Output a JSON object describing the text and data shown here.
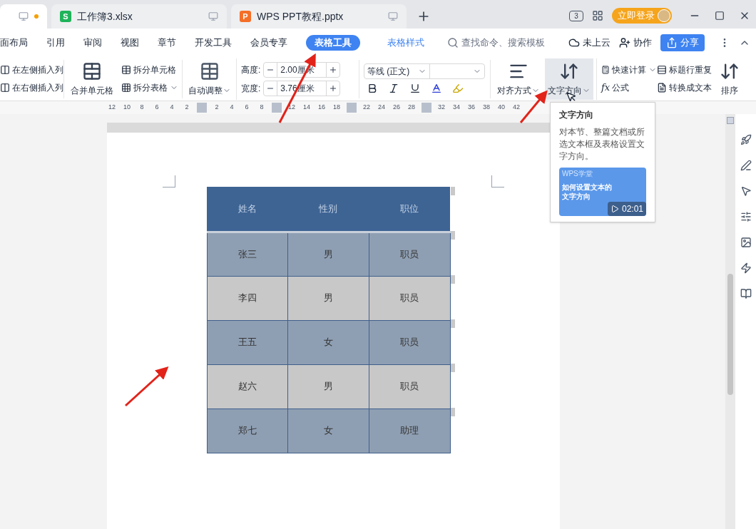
{
  "tabs": [
    {
      "selected": true,
      "modified": true
    },
    {
      "label": "工作簿3.xlsx",
      "logo": "S",
      "color": "#1fb35b",
      "selected": false,
      "modified": false
    },
    {
      "label": "WPS PPT教程.pptx",
      "logo": "P",
      "color": "#f46f27",
      "selected": false,
      "modified": false
    }
  ],
  "title_bar": {
    "login": "立即登录",
    "page_count": "3"
  },
  "menu": {
    "items": [
      {
        "label": "面布局",
        "kind": "plain"
      },
      {
        "label": "引用",
        "kind": "plain"
      },
      {
        "label": "审阅",
        "kind": "plain"
      },
      {
        "label": "视图",
        "kind": "plain"
      },
      {
        "label": "章节",
        "kind": "plain"
      },
      {
        "label": "开发工具",
        "kind": "plain"
      },
      {
        "label": "会员专享",
        "kind": "plain"
      },
      {
        "label": "表格工具",
        "kind": "context",
        "selected": true
      },
      {
        "label": "表格样式",
        "kind": "context",
        "selected": false
      }
    ],
    "search": {
      "placeholder": "查找命令、搜索模板"
    },
    "cloud": "未上云",
    "collab": "协作",
    "share": "分享"
  },
  "ribbon": {
    "insert_left": "在左侧插入列",
    "insert_right": "在右侧插入列",
    "merge": "合并单元格",
    "split_cell": "拆分单元格",
    "split_table": "拆分表格",
    "autofit": "自动调整",
    "height": {
      "label": "高度:",
      "value": "2.00厘米"
    },
    "width": {
      "label": "宽度:",
      "value": "3.76厘米"
    },
    "font": {
      "value": "等线 (正文)"
    },
    "align": "对齐方式",
    "direction": {
      "label": "文字方向",
      "hovered": true
    },
    "quick_calc": "快速计算",
    "formula_symbol": "fx",
    "formula": "公式",
    "repeat_header": "标题行重复",
    "to_text": "转换成文本",
    "sort": "排序"
  },
  "ruler": [
    {
      "kind": "num",
      "label": "12"
    },
    {
      "kind": "num",
      "label": "10"
    },
    {
      "kind": "num",
      "label": "8"
    },
    {
      "kind": "num",
      "label": "6"
    },
    {
      "kind": "num",
      "label": "4"
    },
    {
      "kind": "num",
      "label": "2"
    },
    {
      "kind": "marker"
    },
    {
      "kind": "num",
      "label": "2"
    },
    {
      "kind": "num",
      "label": "4"
    },
    {
      "kind": "num",
      "label": "6"
    },
    {
      "kind": "num",
      "label": "8"
    },
    {
      "kind": "marker"
    },
    {
      "kind": "num",
      "label": "12"
    },
    {
      "kind": "num",
      "label": "14"
    },
    {
      "kind": "num",
      "label": "16"
    },
    {
      "kind": "num",
      "label": "18"
    },
    {
      "kind": "marker"
    },
    {
      "kind": "num",
      "label": "22"
    },
    {
      "kind": "num",
      "label": "24"
    },
    {
      "kind": "num",
      "label": "26"
    },
    {
      "kind": "num",
      "label": "28"
    },
    {
      "kind": "marker"
    },
    {
      "kind": "num",
      "label": "32"
    },
    {
      "kind": "num",
      "label": "34"
    },
    {
      "kind": "num",
      "label": "36"
    },
    {
      "kind": "num",
      "label": "38"
    },
    {
      "kind": "num",
      "label": "40"
    },
    {
      "kind": "num",
      "label": "42"
    }
  ],
  "tooltip": {
    "title": "文字方向",
    "description": "对本节、整篇文档或所选文本框及表格设置文字方向。",
    "video": {
      "source": "WPS学堂",
      "title": "如何设置文本的文字方向",
      "duration": "02:01"
    }
  },
  "table": {
    "columns": [
      "姓名",
      "性别",
      "职位"
    ],
    "rows": [
      {
        "cells": [
          "张三",
          "男",
          "职员"
        ],
        "color": "#8f9fb3"
      },
      {
        "cells": [
          "李四",
          "男",
          "职员"
        ],
        "color": "#c8c8c8"
      },
      {
        "cells": [
          "王五",
          "女",
          "职员"
        ],
        "color": "#8f9fb3"
      },
      {
        "cells": [
          "赵六",
          "男",
          "职员"
        ],
        "color": "#c8c8c8"
      },
      {
        "cells": [
          "郑七",
          "女",
          "助理"
        ],
        "color": "#8f9fb3"
      }
    ]
  }
}
